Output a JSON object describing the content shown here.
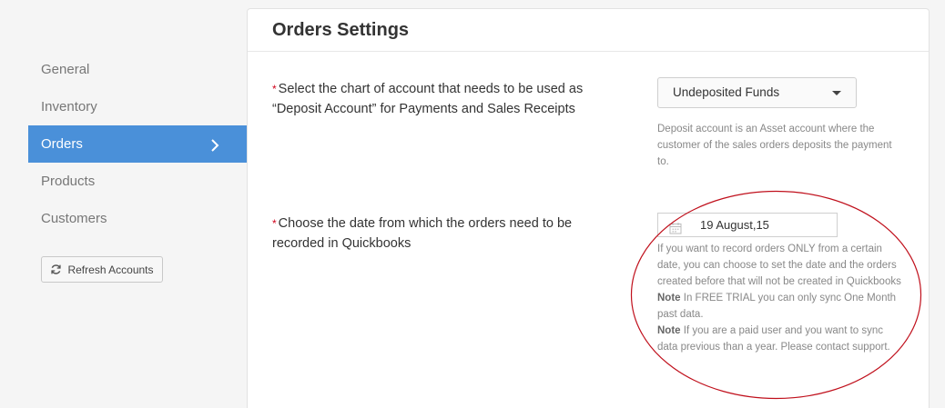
{
  "sidebar": {
    "items": [
      {
        "label": "General"
      },
      {
        "label": "Inventory"
      },
      {
        "label": "Orders"
      },
      {
        "label": "Products"
      },
      {
        "label": "Customers"
      }
    ],
    "refresh_label": "Refresh Accounts"
  },
  "panel": {
    "title": "Orders Settings",
    "deposit": {
      "required_mark": "*",
      "label_line1": "Select the chart of account that needs to be used as",
      "label_line2": "“Deposit Account” for Payments and Sales Receipts",
      "selected": "Undeposited Funds",
      "help": "Deposit account is an Asset account where the customer of the sales orders deposits the payment to."
    },
    "date": {
      "required_mark": "*",
      "label_line1": "Choose the date from which the orders need to be",
      "label_line2": "recorded in Quickbooks",
      "value": "19 August,15",
      "help_main": "If you want to record orders ONLY from a certain date, you can choose to set the date and the orders created before that will not be created in Quickbooks",
      "note1_label": "Note",
      "note1_text": " In FREE TRIAL you can only sync One Month past data.",
      "note2_label": "Note",
      "note2_text": " If you are a paid user and you want to sync data previous than a year. Please contact support."
    }
  },
  "colors": {
    "active_bg": "#4a90d9",
    "required": "#d0021b",
    "annotation": "#c0101c"
  },
  "icons": {
    "chevron": "chevron-right-icon",
    "refresh": "refresh-icon",
    "calendar": "calendar-icon",
    "dropdown": "caret-down-icon"
  }
}
